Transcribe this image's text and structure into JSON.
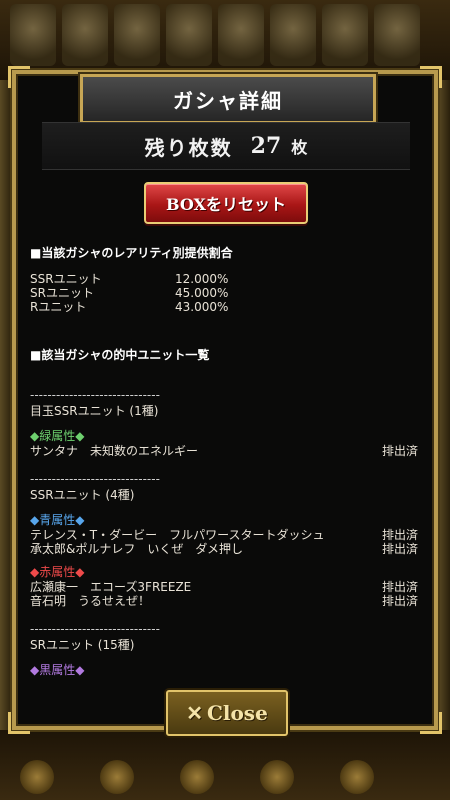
{
  "header": {
    "title": "ガシャ詳細"
  },
  "remaining": {
    "label": "残り枚数",
    "count": "27",
    "unit": "枚"
  },
  "reset_button": {
    "label": "BOXをリセット"
  },
  "rates": {
    "heading": "■当該ガシャのレアリティ別提供割合",
    "rows": [
      {
        "name": "SSRユニット",
        "value": "12.000%"
      },
      {
        "name": "SRユニット",
        "value": "45.000%"
      },
      {
        "name": "Rユニット",
        "value": "43.000%"
      }
    ]
  },
  "units": {
    "heading": "■該当ガシャの的中ユニット一覧",
    "divider": "------------------------------",
    "featured": {
      "title": "目玉SSRユニット (1種)",
      "attribute": "◆緑属性◆",
      "items": [
        {
          "name": "サンタナ　未知数のエネルギー",
          "status": "排出済"
        }
      ]
    },
    "ssr": {
      "title": "SSRユニット (4種)",
      "blue": {
        "attribute": "◆青属性◆",
        "items": [
          {
            "name": "テレンス・T・ダービー　フルパワースタートダッシュ",
            "status": "排出済"
          },
          {
            "name": "承太郎&ポルナレフ　いくぜ　ダメ押し",
            "status": "排出済"
          }
        ]
      },
      "red": {
        "attribute": "◆赤属性◆",
        "items": [
          {
            "name": "広瀬康一　エコーズ3FREEZE",
            "status": "排出済"
          },
          {
            "name": "音石明　うるせえぜ！",
            "status": "排出済"
          }
        ]
      }
    },
    "sr": {
      "title": "SRユニット (15種)",
      "attribute": "◆黒属性◆"
    }
  },
  "close_button": {
    "icon": "close-x-icon",
    "label": "Close"
  },
  "colors": {
    "frame_gold": "#b89a4e",
    "reset_red": "#a91616",
    "green_attr": "#6ed06e",
    "blue_attr": "#58a6ec",
    "red_attr": "#ee4a4a",
    "purple_attr": "#b27ae0"
  }
}
